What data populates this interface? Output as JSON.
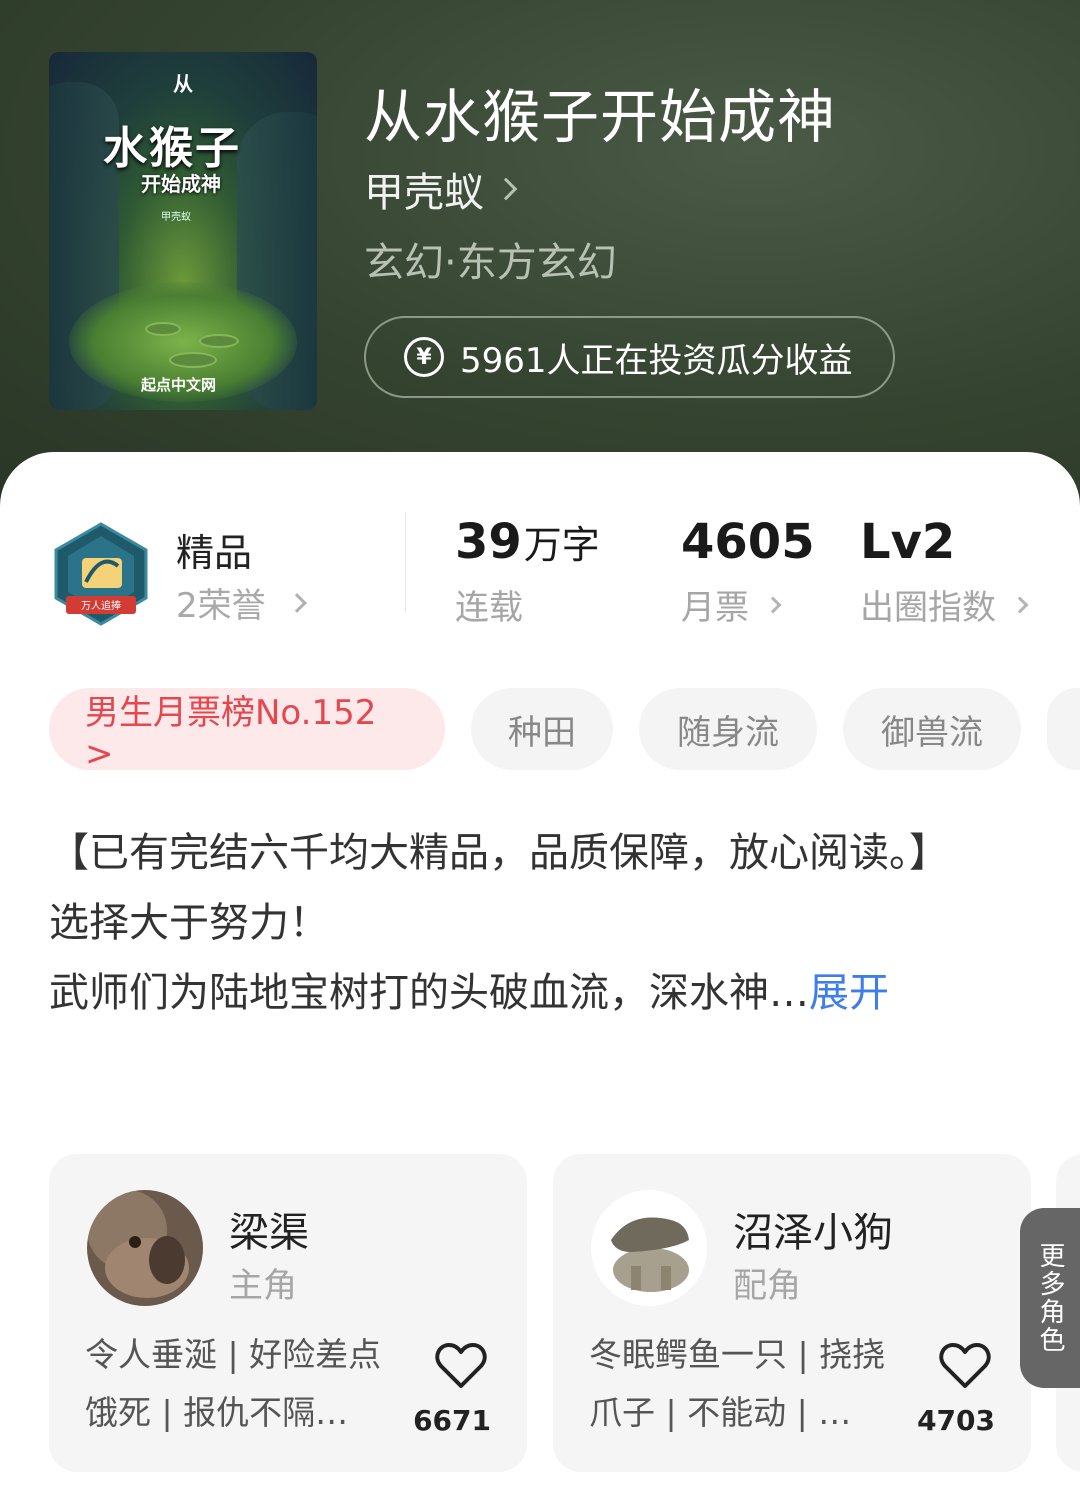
{
  "book": {
    "title": "从水猴子开始成神",
    "author": "甲壳蚁",
    "genre": "玄幻·东方玄幻",
    "invest_text": "5961人正在投资瓜分收益",
    "cover": {
      "top_char": "从",
      "title": "水猴子",
      "subtitle": "开始成神",
      "author": "甲壳蚁",
      "publisher": "起点中文网"
    }
  },
  "stats": {
    "quality": "精品",
    "honors": "2荣誉",
    "badge_text": "万人追捧",
    "words_value": "39",
    "words_unit": "万字",
    "words_label": "连载",
    "monthly_votes_value": "4605",
    "monthly_votes_label": "月票",
    "index_value": "Lv2",
    "index_label": "出圈指数"
  },
  "tags": [
    "男生月票榜No.152 >",
    "种田",
    "随身流",
    "御兽流"
  ],
  "synopsis": {
    "line1": "【已有完结六千均大精品，品质保障，放心阅读。】",
    "line2": "选择大于努力！",
    "line3": "武师们为陆地宝树打的头破血流，深水神…",
    "expand_label": "展开"
  },
  "characters": [
    {
      "name": "梁渠",
      "role": "主角",
      "desc": "令人垂涎 | 好险差点饿死 | 报仇不隔…",
      "likes": "6671"
    },
    {
      "name": "沼泽小狗",
      "role": "配角",
      "desc": "冬眠鳄鱼一只 | 挠挠爪子 | 不能动 | …",
      "likes": "4703"
    }
  ],
  "more_roles_label": "更多角色",
  "icons": {
    "coin": "yen-coin-icon",
    "chevron": "chevron-right-icon",
    "heart": "heart-outline-icon",
    "badge": "hexagon-badge-icon"
  },
  "colors": {
    "header_bg": "#34432f",
    "rank_tag_bg": "#fde8ea",
    "rank_tag_text": "#e5474f",
    "expand_link": "#3f7ee8"
  }
}
